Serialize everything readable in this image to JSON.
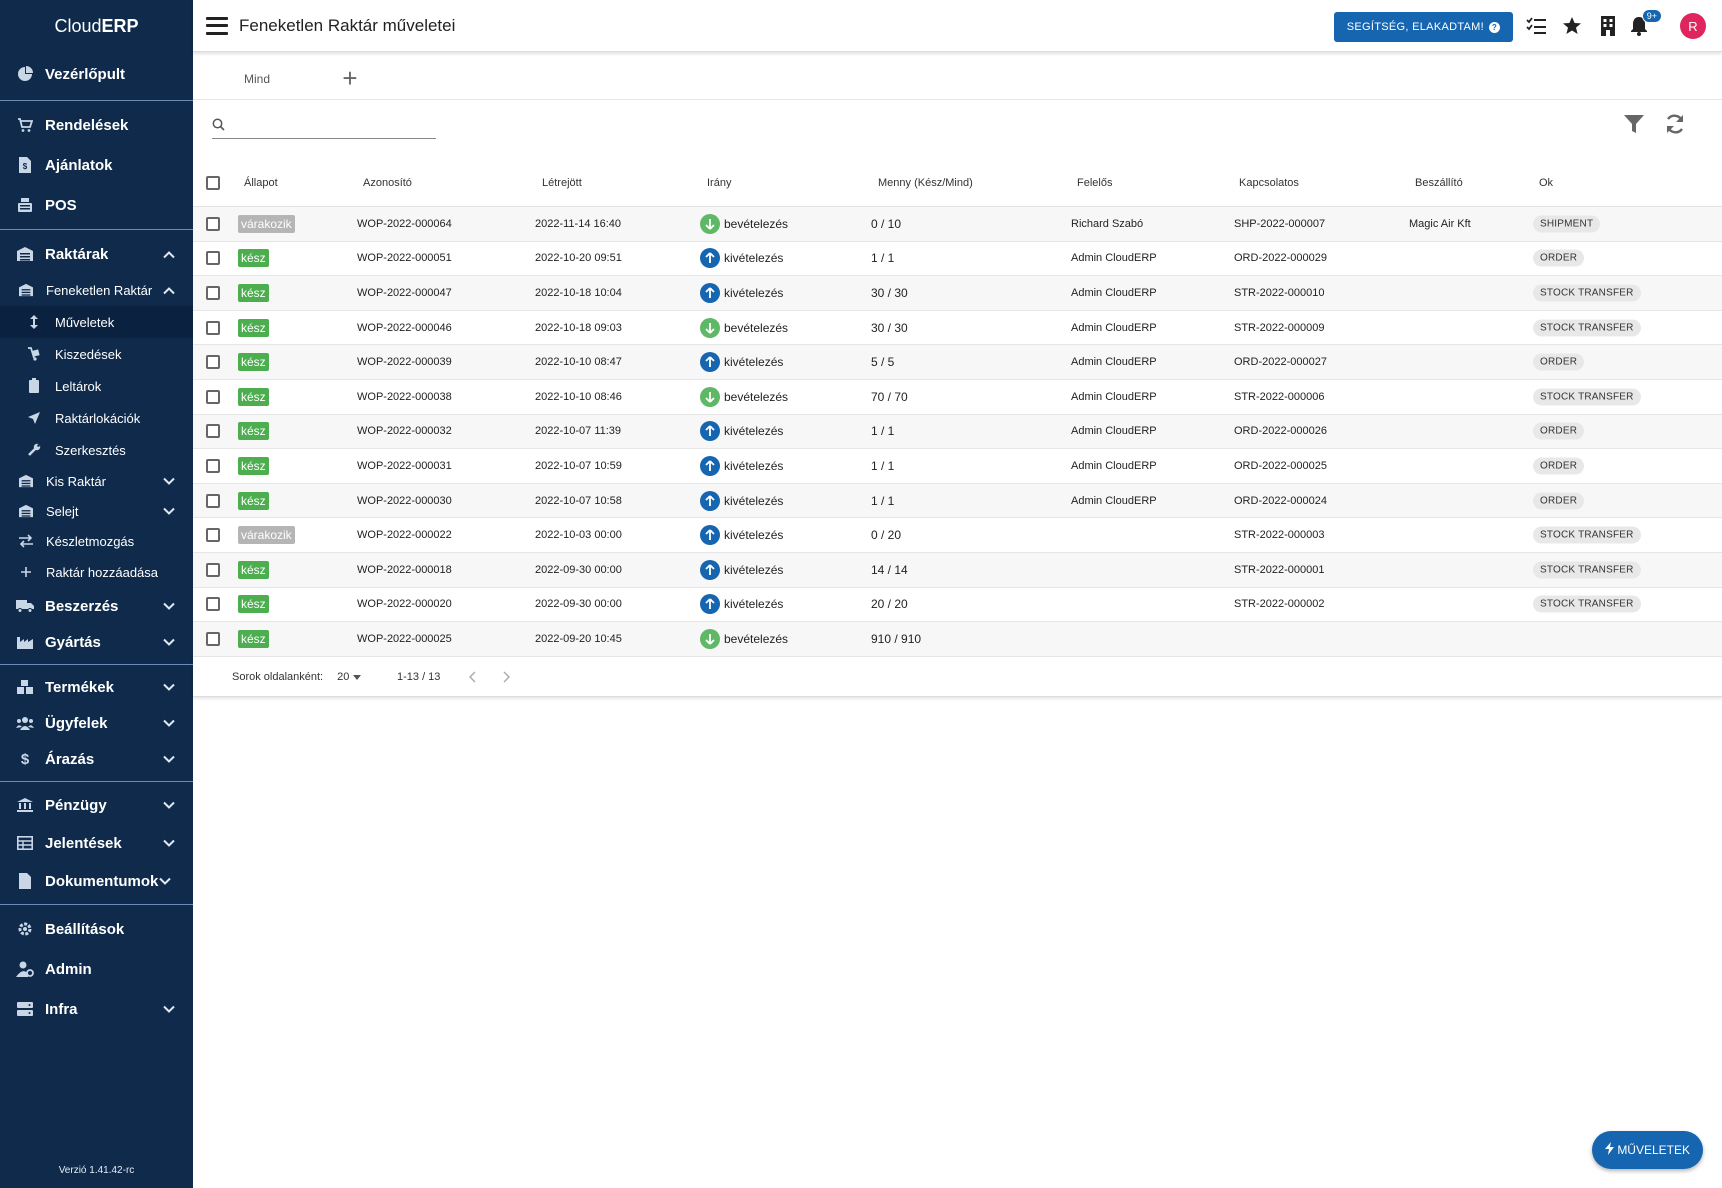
{
  "app": {
    "brand_light": "Cloud",
    "brand_bold": "ERP",
    "version": "Verzió 1.41.42-rc"
  },
  "header": {
    "title": "Feneketlen Raktár műveletei",
    "help_label": "SEGÍTSÉG, ELAKADTAM!",
    "notif_badge": "9+",
    "avatar_initial": "R"
  },
  "sidebar": {
    "dashboard": "Vezérlőpult",
    "orders": "Rendelések",
    "offers": "Ajánlatok",
    "pos": "POS",
    "warehouses": "Raktárak",
    "wh_feneketlen": "Feneketlen Raktár",
    "operations": "Műveletek",
    "picking": "Kiszedések",
    "inventory": "Leltárok",
    "locations": "Raktárlokációk",
    "edit": "Szerkesztés",
    "wh_small": "Kis Raktár",
    "wh_scrap": "Selejt",
    "stock_moves": "Készletmozgás",
    "add_wh": "Raktár hozzáadása",
    "purchasing": "Beszerzés",
    "manufacturing": "Gyártás",
    "products": "Termékek",
    "customers": "Ügyfelek",
    "pricing": "Árazás",
    "finance": "Pénzügy",
    "reports": "Jelentések",
    "documents": "Dokumentumok",
    "settings": "Beállítások",
    "admin": "Admin",
    "infra": "Infra"
  },
  "tabs": {
    "all": "Mind"
  },
  "search": {
    "placeholder": ""
  },
  "table": {
    "columns": {
      "status": "Állapot",
      "id": "Azonosító",
      "created": "Létrejött",
      "direction": "Irány",
      "qty": "Menny (Kész/Mind)",
      "owner": "Felelős",
      "related": "Kapcsolatos",
      "supplier": "Beszállító",
      "reason": "Ok"
    },
    "rows": [
      {
        "status": "várakozik",
        "state": "wait",
        "id": "WOP-2022-000064",
        "created": "2022-11-14 16:40",
        "dir": "in",
        "dir_label": "bevételezés",
        "qty": "0 / 10",
        "owner": "Richard Szabó",
        "related": "SHP-2022-000007",
        "supplier": "Magic Air Kft",
        "reason": "SHIPMENT"
      },
      {
        "status": "kész",
        "state": "done",
        "id": "WOP-2022-000051",
        "created": "2022-10-20 09:51",
        "dir": "out",
        "dir_label": "kivételezés",
        "qty": "1 / 1",
        "owner": "Admin CloudERP",
        "related": "ORD-2022-000029",
        "supplier": "",
        "reason": "ORDER"
      },
      {
        "status": "kész",
        "state": "done",
        "id": "WOP-2022-000047",
        "created": "2022-10-18 10:04",
        "dir": "out",
        "dir_label": "kivételezés",
        "qty": "30 / 30",
        "owner": "Admin CloudERP",
        "related": "STR-2022-000010",
        "supplier": "",
        "reason": "STOCK TRANSFER"
      },
      {
        "status": "kész",
        "state": "done",
        "id": "WOP-2022-000046",
        "created": "2022-10-18 09:03",
        "dir": "in",
        "dir_label": "bevételezés",
        "qty": "30 / 30",
        "owner": "Admin CloudERP",
        "related": "STR-2022-000009",
        "supplier": "",
        "reason": "STOCK TRANSFER"
      },
      {
        "status": "kész",
        "state": "done",
        "id": "WOP-2022-000039",
        "created": "2022-10-10 08:47",
        "dir": "out",
        "dir_label": "kivételezés",
        "qty": "5 / 5",
        "owner": "Admin CloudERP",
        "related": "ORD-2022-000027",
        "supplier": "",
        "reason": "ORDER"
      },
      {
        "status": "kész",
        "state": "done",
        "id": "WOP-2022-000038",
        "created": "2022-10-10 08:46",
        "dir": "in",
        "dir_label": "bevételezés",
        "qty": "70 / 70",
        "owner": "Admin CloudERP",
        "related": "STR-2022-000006",
        "supplier": "",
        "reason": "STOCK TRANSFER"
      },
      {
        "status": "kész",
        "state": "done",
        "id": "WOP-2022-000032",
        "created": "2022-10-07 11:39",
        "dir": "out",
        "dir_label": "kivételezés",
        "qty": "1 / 1",
        "owner": "Admin CloudERP",
        "related": "ORD-2022-000026",
        "supplier": "",
        "reason": "ORDER"
      },
      {
        "status": "kész",
        "state": "done",
        "id": "WOP-2022-000031",
        "created": "2022-10-07 10:59",
        "dir": "out",
        "dir_label": "kivételezés",
        "qty": "1 / 1",
        "owner": "Admin CloudERP",
        "related": "ORD-2022-000025",
        "supplier": "",
        "reason": "ORDER"
      },
      {
        "status": "kész",
        "state": "done",
        "id": "WOP-2022-000030",
        "created": "2022-10-07 10:58",
        "dir": "out",
        "dir_label": "kivételezés",
        "qty": "1 / 1",
        "owner": "Admin CloudERP",
        "related": "ORD-2022-000024",
        "supplier": "",
        "reason": "ORDER"
      },
      {
        "status": "várakozik",
        "state": "wait",
        "id": "WOP-2022-000022",
        "created": "2022-10-03 00:00",
        "dir": "out",
        "dir_label": "kivételezés",
        "qty": "0 / 20",
        "owner": "",
        "related": "STR-2022-000003",
        "supplier": "",
        "reason": "STOCK TRANSFER"
      },
      {
        "status": "kész",
        "state": "done",
        "id": "WOP-2022-000018",
        "created": "2022-09-30 00:00",
        "dir": "out",
        "dir_label": "kivételezés",
        "qty": "14 / 14",
        "owner": "",
        "related": "STR-2022-000001",
        "supplier": "",
        "reason": "STOCK TRANSFER"
      },
      {
        "status": "kész",
        "state": "done",
        "id": "WOP-2022-000020",
        "created": "2022-09-30 00:00",
        "dir": "out",
        "dir_label": "kivételezés",
        "qty": "20 / 20",
        "owner": "",
        "related": "STR-2022-000002",
        "supplier": "",
        "reason": "STOCK TRANSFER"
      },
      {
        "status": "kész",
        "state": "done",
        "id": "WOP-2022-000025",
        "created": "2022-09-20 10:45",
        "dir": "in",
        "dir_label": "bevételezés",
        "qty": "910 / 910",
        "owner": "",
        "related": "",
        "supplier": "",
        "reason": ""
      }
    ]
  },
  "pager": {
    "rows_label": "Sorok oldalanként:",
    "rows_value": "20",
    "range": "1-13 / 13"
  },
  "fab": {
    "label": "MŰVELETEK"
  },
  "colors": {
    "sidebar": "#0f2a4a",
    "accent": "#1565b0",
    "done": "#4cae4f",
    "wait": "#b5b5b5",
    "in": "#5fb865",
    "avatar": "#e0245e"
  }
}
